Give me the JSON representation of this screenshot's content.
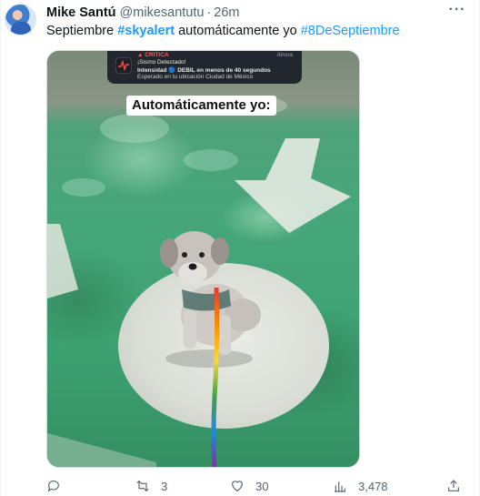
{
  "tweet": {
    "author_name": "Mike Santú",
    "handle": "@mikesantutu",
    "separator": "·",
    "time": "26m",
    "more_label": "···",
    "text_pre": "Septiembre ",
    "hashtag1": "#skyalert",
    "text_mid": " automáticamente yo ",
    "hashtag2": "#8DeSeptiembre"
  },
  "media": {
    "notification": {
      "label": "▲ CRITICA",
      "time": "Ahora",
      "line1": "¡Sismo Detectado!",
      "line2": "Intensidad 🔵 DEBIL en menos de 40 segundos",
      "line3": "Esperado en tu ubicación Ciudad de México"
    },
    "caption": "Automáticamente yo:"
  },
  "actions": {
    "replies": "",
    "retweets": "3",
    "likes": "30",
    "views": "3,478"
  },
  "colors": {
    "accent": "#1d9bf0",
    "muted": "#536471",
    "pavement_green": "#3fae7c"
  },
  "icons": [
    "reply-icon",
    "retweet-icon",
    "like-icon",
    "views-icon",
    "share-icon",
    "more-icon"
  ]
}
